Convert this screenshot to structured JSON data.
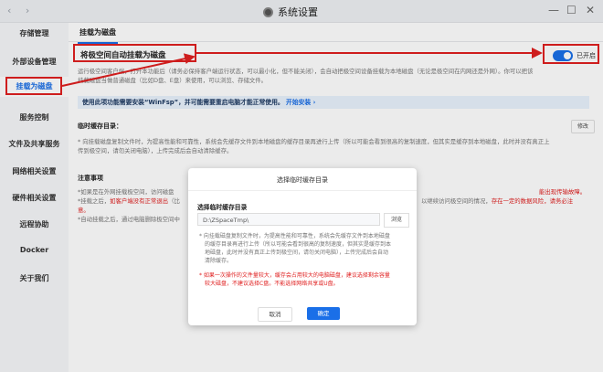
{
  "window": {
    "title": "系统设置",
    "back": "‹",
    "forward": "›",
    "min": "—",
    "max": "☐",
    "close": "✕"
  },
  "sidebar": {
    "items": [
      {
        "label": "存储管理"
      },
      {
        "label": "外部设备管理"
      },
      {
        "label": "挂载为磁盘"
      },
      {
        "label": "服务控制"
      },
      {
        "label": "文件及共享服务"
      },
      {
        "label": "网络相关设置"
      },
      {
        "label": "硬件相关设置"
      },
      {
        "label": "远程协助"
      },
      {
        "label": "Docker"
      },
      {
        "label": "关于我们"
      }
    ]
  },
  "main": {
    "tab": "挂载为磁盘",
    "heading": "将极空间自动挂载为磁盘",
    "toggle_label": "已开启",
    "desc1": "运行极空间客户端，打开本功能后（请务必保持客户端运行状态，可以最小化，但不能关闭），会自动把极空间设备挂载为本地磁盘（无论是极空间在内网还是外网）。你可以把该",
    "desc2": "挂载磁盘当做普通磁盘（比如D盘、E盘）来使用，可以浏览、存储文件。",
    "winfsp_note": "使用此项功能需要安装“WinFsp”，并可能需要重启电脑才能正常使用。",
    "winfsp_link": "开始安装 ›",
    "cache_title": "临时缓存目录：",
    "edit_btn": "修改",
    "cache_desc1": "* 向挂载磁盘复制文件时，为提高性能和可靠性，系统会先缓存文件到本地磁盘的缓存目录再进行上传（所以可能会看到很高的复制速度，但其实是缓存到本地磁盘，此时并没有真正上",
    "cache_desc2": "传到极空间，请勿关闭电脑），上传完成后会自动清除缓存。",
    "notice_title": "注意事项",
    "notice1": "*如果是在外网挂载极空间，访问磁盘",
    "notice1_red": "能出现传输故障。",
    "notice2": "*挂载之后，",
    "notice2_red": "如客户端没有正常退出",
    "notice2_b": "（比",
    "notice2_c": "以继续访问极空间的情况，",
    "notice2_red2": "存在一定的数据风险，请务必注",
    "notice3": "意。",
    "notice4": "*自动挂载之后，通过电脑删除极空间中"
  },
  "dialog": {
    "title": "选择临时缓存目录",
    "field_label": "选择临时缓存目录",
    "path": "D:\\ZSpaceTmp\\",
    "browse": "浏览",
    "desc1": "* 向挂载磁盘复制文件时，为提高性能和可靠性，系统会先缓存文件到本地磁盘",
    "desc2": "的缓存目录再进行上传（所以可能会看到很高的复制速度，但其实是缓存到本",
    "desc3": "地磁盘，此时并没有真正上传到极空间，请勿关闭电脑），上传完成后会自动",
    "desc4": "清除缓存。",
    "warn1": "* 如果一次操作的文件量较大，缓存会占用较大的电脑磁盘，建议选择剩余容量",
    "warn2": "较大磁盘，不建议选择C盘。不能选择网络共享或U盘。",
    "cancel": "取消",
    "confirm": "确定"
  },
  "colors": {
    "accent": "#1a6fe8",
    "annotation": "#e02020"
  }
}
